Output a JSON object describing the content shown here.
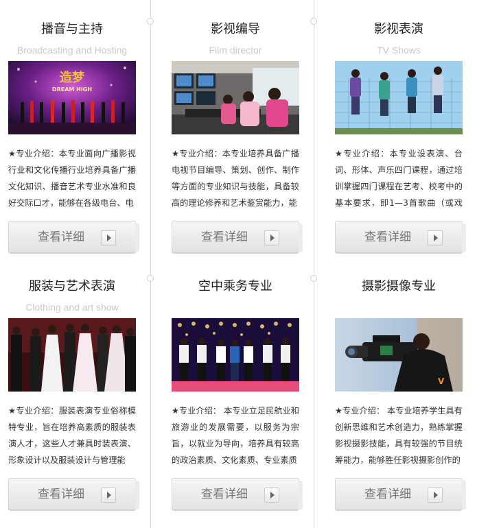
{
  "cards": [
    {
      "title": "播音与主持",
      "subtitle": "Broadcasting and Hosting",
      "description": "★专业介绍：本专业面向广播影视行业和文化传播行业培养具备广播文化知识、播音艺术专业水准和良好交际口才，能够在各级电台、电",
      "button_label": "查看详细",
      "image_text": "DREAM HIGH",
      "image_icon": "stage-show-photo-icon"
    },
    {
      "title": "影视编导",
      "subtitle": "Film director",
      "description": "★专业介绍：本专业培养具备广播电视节目编导、策划、创作、制作等方面的专业知识与技能，具备较高的理论修养和艺术鉴赏能力，能",
      "button_label": "查看详细",
      "image_icon": "control-room-photo-icon"
    },
    {
      "title": "影视表演",
      "subtitle": "TV Shows",
      "description": "★专业介绍：本专业设表演、台词、形体、声乐四门课程，通过培训掌握四门课程在艺考、校考中的基本要求，即1—3首歌曲（或戏剧",
      "button_label": "查看详细",
      "image_icon": "jumping-students-photo-icon"
    },
    {
      "title": "服装与艺术表演",
      "subtitle": "Clothing and art show",
      "description": "★专业介绍：服装表演专业俗称模特专业，旨在培养高素质的服装表演人才，这些人才兼具时装表演、形象设计以及服装设计与管理能",
      "button_label": "查看详细",
      "image_icon": "fashion-models-photo-icon"
    },
    {
      "title": "空中乘务专业",
      "subtitle": "",
      "description": "★专业介绍： 本专业立足民航业和旅游业的发展需要，以服务为宗旨，以就业为导向，培养具有较高的政治素质、文化素质、专业素质",
      "button_label": "查看详细",
      "image_icon": "flight-crew-photo-icon"
    },
    {
      "title": "摄影摄像专业",
      "subtitle": "",
      "description": " ★专业介绍： 本专业培养学生具有创新思维和艺术创造力，熟练掌握影视摄影技能，具有较强的节目统筹能力，能够胜任影视摄影创作的",
      "button_label": "查看详细",
      "image_icon": "camera-operator-photo-icon"
    }
  ],
  "colors": {
    "title": "#222222",
    "subtitle": "#c9c9c9",
    "button_text": "#777777",
    "divider": "#d9d9d9"
  }
}
